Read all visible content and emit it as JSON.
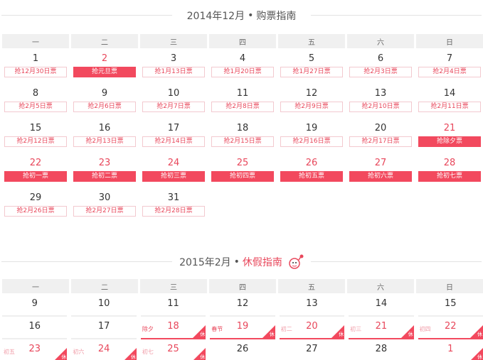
{
  "december": {
    "title": "2014年12月",
    "separator": "•",
    "subtitle": "购票指南",
    "weekdays": [
      "一",
      "二",
      "三",
      "四",
      "五",
      "六",
      "日"
    ],
    "days": [
      {
        "day": "1",
        "tag": "抢12月30日票"
      },
      {
        "day": "2",
        "tag": "抢元旦票",
        "highlight": true
      },
      {
        "day": "3",
        "tag": "抢1月13日票"
      },
      {
        "day": "4",
        "tag": "抢1月20日票"
      },
      {
        "day": "5",
        "tag": "抢1月27日票"
      },
      {
        "day": "6",
        "tag": "抢2月3日票"
      },
      {
        "day": "7",
        "tag": "抢2月4日票"
      },
      {
        "day": "8",
        "tag": "抢2月5日票"
      },
      {
        "day": "9",
        "tag": "抢2月6日票"
      },
      {
        "day": "10",
        "tag": "抢2月7日票"
      },
      {
        "day": "11",
        "tag": "抢2月8日票"
      },
      {
        "day": "12",
        "tag": "抢2月9日票"
      },
      {
        "day": "13",
        "tag": "抢2月10日票"
      },
      {
        "day": "14",
        "tag": "抢2月11日票"
      },
      {
        "day": "15",
        "tag": "抢2月12日票"
      },
      {
        "day": "16",
        "tag": "抢2月13日票"
      },
      {
        "day": "17",
        "tag": "抢2月14日票"
      },
      {
        "day": "18",
        "tag": "抢2月15日票"
      },
      {
        "day": "19",
        "tag": "抢2月16日票"
      },
      {
        "day": "20",
        "tag": "抢2月17日票"
      },
      {
        "day": "21",
        "tag": "抢除夕票",
        "highlight": true
      },
      {
        "day": "22",
        "tag": "抢初一票",
        "highlight": true
      },
      {
        "day": "23",
        "tag": "抢初二票",
        "highlight": true
      },
      {
        "day": "24",
        "tag": "抢初三票",
        "highlight": true
      },
      {
        "day": "25",
        "tag": "抢初四票",
        "highlight": true
      },
      {
        "day": "26",
        "tag": "抢初五票",
        "highlight": true
      },
      {
        "day": "27",
        "tag": "抢初六票",
        "highlight": true
      },
      {
        "day": "28",
        "tag": "抢初七票",
        "highlight": true
      },
      {
        "day": "29",
        "tag": "抢2月26日票"
      },
      {
        "day": "30",
        "tag": "抢2月27日票"
      },
      {
        "day": "31",
        "tag": "抢2月28日票"
      }
    ]
  },
  "february": {
    "title": "2015年2月",
    "separator": "•",
    "subtitle": "休假指南",
    "weekdays": [
      "一",
      "二",
      "三",
      "四",
      "五",
      "六",
      "日"
    ],
    "holiday_flag": "休",
    "days": [
      {
        "day": "9"
      },
      {
        "day": "10"
      },
      {
        "day": "11"
      },
      {
        "day": "12"
      },
      {
        "day": "13"
      },
      {
        "day": "14"
      },
      {
        "day": "15"
      },
      {
        "day": "16"
      },
      {
        "day": "17"
      },
      {
        "day": "18",
        "lunar": "除夕",
        "holiday": true,
        "strong": true
      },
      {
        "day": "19",
        "lunar": "春节",
        "holiday": true,
        "strong": true
      },
      {
        "day": "20",
        "lunar": "初二",
        "holiday": true
      },
      {
        "day": "21",
        "lunar": "初三",
        "holiday": true
      },
      {
        "day": "22",
        "lunar": "初四",
        "holiday": true
      },
      {
        "day": "23",
        "lunar": "初五",
        "holiday": true
      },
      {
        "day": "24",
        "lunar": "初六",
        "holiday": true
      },
      {
        "day": "25",
        "lunar": "初七",
        "holiday": true
      },
      {
        "day": "26"
      },
      {
        "day": "27"
      },
      {
        "day": "28"
      },
      {
        "day": "1",
        "holiday": true
      }
    ]
  },
  "colors": {
    "accent": "#e8475b",
    "tag_fill": "#f2495e",
    "header_bg": "#f0f0f0"
  }
}
